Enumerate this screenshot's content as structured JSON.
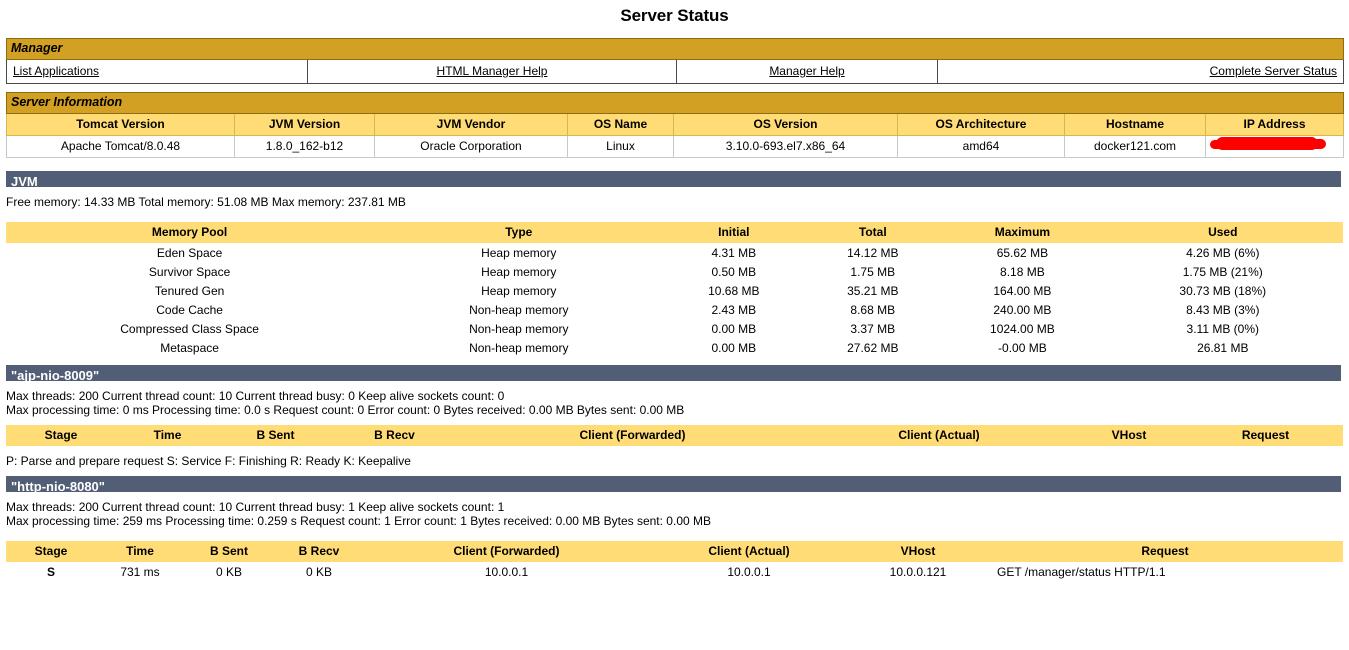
{
  "page": {
    "title": "Server Status"
  },
  "manager": {
    "section_label": "Manager",
    "links": [
      {
        "label": "List Applications",
        "align": "left"
      },
      {
        "label": "HTML Manager Help",
        "align": "center"
      },
      {
        "label": "Manager Help",
        "align": "center"
      },
      {
        "label": "Complete Server Status",
        "align": "right"
      }
    ]
  },
  "server_information": {
    "section_label": "Server Information",
    "columns": [
      "Tomcat Version",
      "JVM Version",
      "JVM Vendor",
      "OS Name",
      "OS Version",
      "OS Architecture",
      "Hostname",
      "IP Address"
    ],
    "row": {
      "tomcat_version": "Apache Tomcat/8.0.48",
      "jvm_version": "1.8.0_162-b12",
      "jvm_vendor": "Oracle Corporation",
      "os_name": "Linux",
      "os_version": "3.10.0-693.el7.x86_64",
      "os_architecture": "amd64",
      "hostname": "docker121.com",
      "ip_address": ""
    }
  },
  "jvm": {
    "section_label": "JVM",
    "summary": "Free memory: 14.33 MB Total memory: 51.08 MB Max memory: 237.81 MB",
    "columns": [
      "Memory Pool",
      "Type",
      "Initial",
      "Total",
      "Maximum",
      "Used"
    ],
    "rows": [
      {
        "pool": "Eden Space",
        "type": "Heap memory",
        "initial": "4.31 MB",
        "total": "14.12 MB",
        "maximum": "65.62 MB",
        "used": "4.26 MB (6%)"
      },
      {
        "pool": "Survivor Space",
        "type": "Heap memory",
        "initial": "0.50 MB",
        "total": "1.75 MB",
        "maximum": "8.18 MB",
        "used": "1.75 MB (21%)"
      },
      {
        "pool": "Tenured Gen",
        "type": "Heap memory",
        "initial": "10.68 MB",
        "total": "35.21 MB",
        "maximum": "164.00 MB",
        "used": "30.73 MB (18%)"
      },
      {
        "pool": "Code Cache",
        "type": "Non-heap memory",
        "initial": "2.43 MB",
        "total": "8.68 MB",
        "maximum": "240.00 MB",
        "used": "8.43 MB (3%)"
      },
      {
        "pool": "Compressed Class Space",
        "type": "Non-heap memory",
        "initial": "0.00 MB",
        "total": "3.37 MB",
        "maximum": "1024.00 MB",
        "used": "3.11 MB (0%)"
      },
      {
        "pool": "Metaspace",
        "type": "Non-heap memory",
        "initial": "0.00 MB",
        "total": "27.62 MB",
        "maximum": "-0.00 MB",
        "used": "26.81 MB"
      }
    ]
  },
  "connector_ajp": {
    "section_label": "\"ajp-nio-8009\"",
    "threads_line": "Max threads: 200 Current thread count: 10 Current thread busy: 0 Keep alive sockets count: 0",
    "processing_line": "Max processing time: 0 ms Processing time: 0.0 s Request count: 0 Error count: 0 Bytes received: 0.00 MB Bytes sent: 0.00 MB",
    "columns": [
      "Stage",
      "Time",
      "B Sent",
      "B Recv",
      "Client (Forwarded)",
      "Client (Actual)",
      "VHost",
      "Request"
    ],
    "rows": [],
    "legend": "P: Parse and prepare request S: Service F: Finishing R: Ready K: Keepalive"
  },
  "connector_http": {
    "section_label": "\"http-nio-8080\"",
    "threads_line": "Max threads: 200 Current thread count: 10 Current thread busy: 1 Keep alive sockets count: 1",
    "processing_line": "Max processing time: 259 ms Processing time: 0.259 s Request count: 1 Error count: 1 Bytes received: 0.00 MB Bytes sent: 0.00 MB",
    "columns": [
      "Stage",
      "Time",
      "B Sent",
      "B Recv",
      "Client (Forwarded)",
      "Client (Actual)",
      "VHost",
      "Request"
    ],
    "rows": [
      {
        "stage": "S",
        "time": "731 ms",
        "b_sent": "0 KB",
        "b_recv": "0 KB",
        "client_forwarded": "10.0.0.1",
        "client_actual": "10.0.0.1",
        "vhost": "10.0.0.121",
        "request": "GET /manager/status HTTP/1.1"
      }
    ]
  },
  "colors": {
    "gold_bar": "#D2A022",
    "gold_header": "#FFDC75",
    "slate_bar": "#525D76",
    "redaction": "#FF0000",
    "text": "#000000",
    "page_background": "#FFFFFF"
  }
}
